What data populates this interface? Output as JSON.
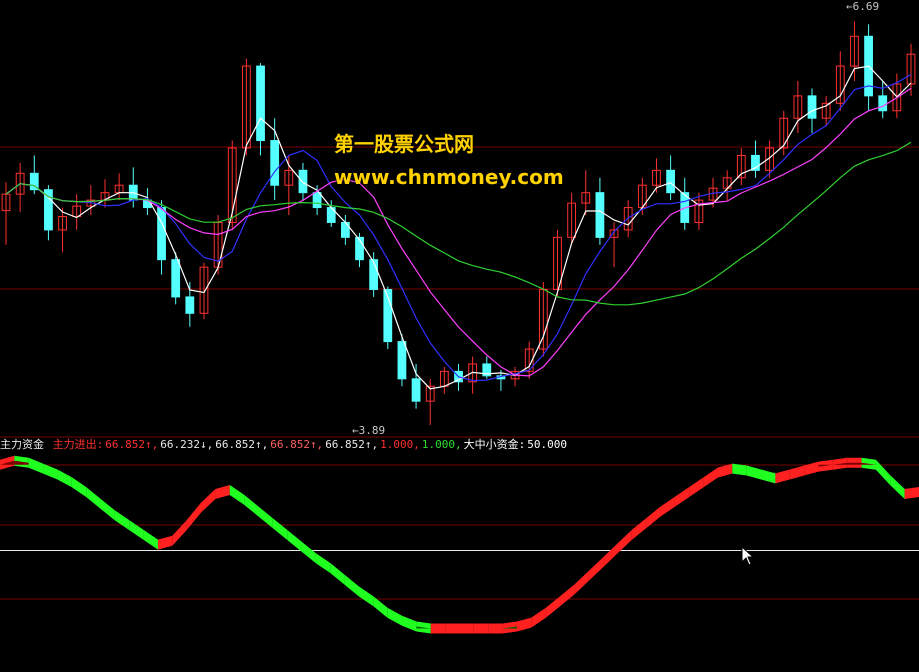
{
  "watermark": {
    "title": "第一股票公式网",
    "url": "www.chnmoney.com"
  },
  "price_panel": {
    "max_label": "6.69",
    "min_label": "3.89"
  },
  "indicator": {
    "name": "主力资金",
    "items": [
      {
        "label": "主力进出:",
        "value": "66.852↑",
        "color": "#ff3030"
      },
      {
        "label": "",
        "value": "66.232↓",
        "color": "#e8e8e8"
      },
      {
        "label": "",
        "value": "66.852↑",
        "color": "#e8e8e8"
      },
      {
        "label": "",
        "value": "66.852↑",
        "color": "#ff6060"
      },
      {
        "label": "",
        "value": "66.852↑",
        "color": "#e8e8e8"
      },
      {
        "label": "",
        "value": "1.000",
        "color": "#ff3030"
      },
      {
        "label": "",
        "value": "1.000",
        "color": "#30e030"
      },
      {
        "label": "大中小资金:",
        "value": "50.000",
        "color": "#ffffff"
      }
    ],
    "level": 50
  },
  "colors": {
    "up": "#ff3030",
    "down": "#54ffff",
    "ma5": "#ffffff",
    "ma10": "#3030ff",
    "ma20": "#ff40ff",
    "ma60": "#30d030",
    "band_up": "#ff2020",
    "band_down": "#20ff20",
    "fill_up": "#7a0000",
    "fill_down": "#006000",
    "grid": "#7a0000"
  },
  "chart_data": {
    "type": "candlestick",
    "price_range": [
      3.89,
      6.69
    ],
    "candles": [
      [
        5.33,
        5.52,
        5.1,
        5.44
      ],
      [
        5.44,
        5.65,
        5.32,
        5.58
      ],
      [
        5.58,
        5.7,
        5.44,
        5.47
      ],
      [
        5.47,
        5.5,
        5.13,
        5.2
      ],
      [
        5.2,
        5.35,
        5.05,
        5.29
      ],
      [
        5.29,
        5.44,
        5.2,
        5.36
      ],
      [
        5.36,
        5.5,
        5.3,
        5.4
      ],
      [
        5.4,
        5.54,
        5.35,
        5.45
      ],
      [
        5.45,
        5.58,
        5.4,
        5.5
      ],
      [
        5.5,
        5.62,
        5.35,
        5.4
      ],
      [
        5.4,
        5.48,
        5.3,
        5.35
      ],
      [
        5.35,
        5.4,
        4.9,
        5.0
      ],
      [
        5.0,
        5.05,
        4.7,
        4.75
      ],
      [
        4.75,
        4.85,
        4.55,
        4.64
      ],
      [
        4.64,
        4.98,
        4.6,
        4.95
      ],
      [
        4.95,
        5.3,
        4.9,
        5.25
      ],
      [
        5.25,
        5.8,
        5.2,
        5.75
      ],
      [
        5.75,
        6.35,
        5.7,
        6.3
      ],
      [
        6.3,
        6.32,
        5.7,
        5.8
      ],
      [
        5.8,
        5.95,
        5.4,
        5.5
      ],
      [
        5.5,
        5.7,
        5.3,
        5.6
      ],
      [
        5.6,
        5.65,
        5.4,
        5.45
      ],
      [
        5.45,
        5.5,
        5.3,
        5.35
      ],
      [
        5.35,
        5.4,
        5.22,
        5.25
      ],
      [
        5.25,
        5.3,
        5.1,
        5.15
      ],
      [
        5.15,
        5.18,
        4.95,
        5.0
      ],
      [
        5.0,
        5.05,
        4.75,
        4.8
      ],
      [
        4.8,
        4.82,
        4.4,
        4.45
      ],
      [
        4.45,
        4.5,
        4.15,
        4.2
      ],
      [
        4.2,
        4.3,
        4.0,
        4.05
      ],
      [
        4.05,
        4.2,
        3.89,
        4.15
      ],
      [
        4.15,
        4.28,
        4.1,
        4.25
      ],
      [
        4.25,
        4.3,
        4.12,
        4.18
      ],
      [
        4.18,
        4.35,
        4.1,
        4.3
      ],
      [
        4.3,
        4.35,
        4.2,
        4.22
      ],
      [
        4.22,
        4.26,
        4.12,
        4.2
      ],
      [
        4.2,
        4.28,
        4.15,
        4.25
      ],
      [
        4.25,
        4.45,
        4.2,
        4.4
      ],
      [
        4.4,
        4.85,
        4.35,
        4.8
      ],
      [
        4.8,
        5.2,
        4.75,
        5.15
      ],
      [
        5.15,
        5.45,
        5.1,
        5.38
      ],
      [
        5.38,
        5.6,
        5.3,
        5.45
      ],
      [
        5.45,
        5.55,
        5.1,
        5.15
      ],
      [
        5.15,
        5.25,
        4.95,
        5.2
      ],
      [
        5.2,
        5.4,
        5.15,
        5.35
      ],
      [
        5.35,
        5.55,
        5.3,
        5.5
      ],
      [
        5.5,
        5.68,
        5.45,
        5.6
      ],
      [
        5.6,
        5.7,
        5.4,
        5.45
      ],
      [
        5.45,
        5.55,
        5.2,
        5.25
      ],
      [
        5.25,
        5.45,
        5.2,
        5.4
      ],
      [
        5.4,
        5.55,
        5.35,
        5.48
      ],
      [
        5.48,
        5.6,
        5.4,
        5.55
      ],
      [
        5.55,
        5.75,
        5.5,
        5.7
      ],
      [
        5.7,
        5.8,
        5.55,
        5.6
      ],
      [
        5.6,
        5.8,
        5.55,
        5.75
      ],
      [
        5.75,
        6.0,
        5.7,
        5.95
      ],
      [
        5.95,
        6.2,
        5.85,
        6.1
      ],
      [
        6.1,
        6.15,
        5.85,
        5.95
      ],
      [
        5.95,
        6.1,
        5.9,
        6.05
      ],
      [
        6.05,
        6.4,
        6.0,
        6.3
      ],
      [
        6.3,
        6.6,
        6.2,
        6.5
      ],
      [
        6.5,
        6.58,
        6.0,
        6.1
      ],
      [
        6.1,
        6.2,
        5.95,
        6.0
      ],
      [
        6.0,
        6.25,
        5.95,
        6.18
      ],
      [
        6.18,
        6.45,
        6.1,
        6.38
      ]
    ],
    "indicator_line": [
      94,
      96,
      95,
      92,
      89,
      85,
      80,
      74,
      68,
      63,
      58,
      53,
      55,
      63,
      72,
      79,
      81,
      76,
      70,
      64,
      58,
      52,
      46,
      41,
      35,
      29,
      24,
      18,
      14,
      11,
      10,
      10,
      10,
      10,
      10,
      10,
      11,
      13,
      18,
      24,
      30,
      37,
      44,
      51,
      58,
      64,
      70,
      75,
      80,
      85,
      90,
      92,
      91,
      89,
      87,
      89,
      91,
      93,
      94,
      95,
      95,
      94,
      86,
      79,
      80
    ]
  }
}
